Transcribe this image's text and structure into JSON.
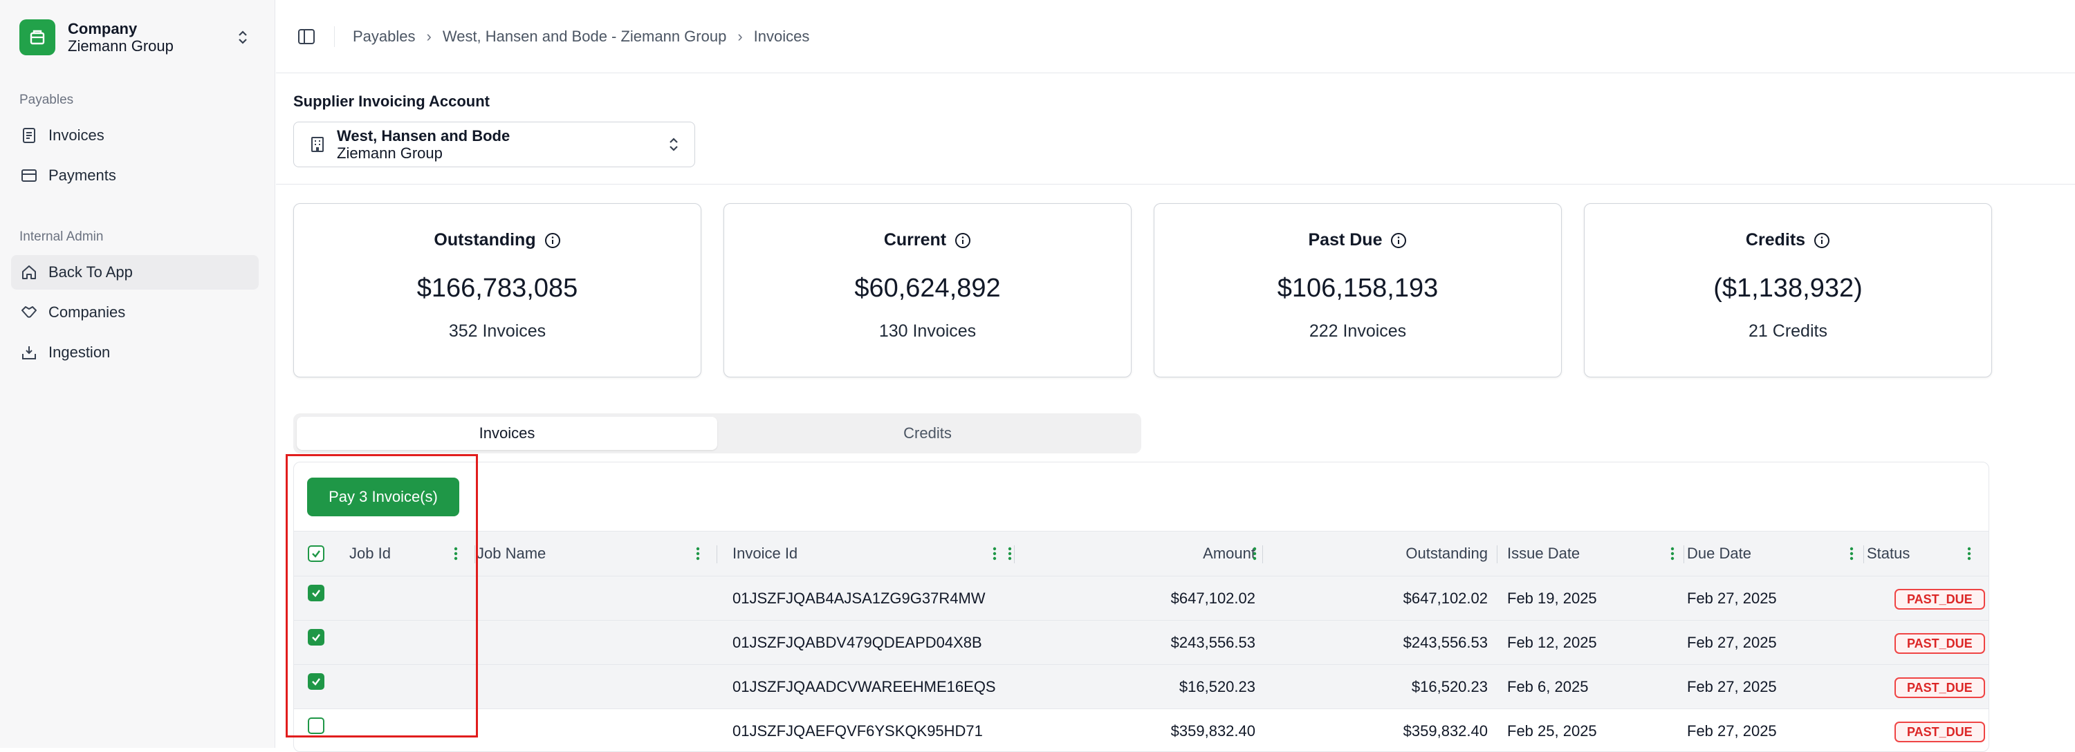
{
  "company": {
    "label": "Company",
    "name": "Ziemann Group"
  },
  "sidebar": {
    "sections": [
      {
        "label": "Payables"
      },
      {
        "label": "Internal Admin"
      }
    ],
    "items": [
      {
        "label": "Invoices",
        "icon": "invoice-icon"
      },
      {
        "label": "Payments",
        "icon": "card-icon"
      },
      {
        "label": "Back To App",
        "icon": "home-icon",
        "active": true
      },
      {
        "label": "Companies",
        "icon": "handshake-icon"
      },
      {
        "label": "Ingestion",
        "icon": "tray-download-icon"
      }
    ]
  },
  "breadcrumb": [
    "Payables",
    "West, Hansen and Bode - Ziemann Group",
    "Invoices"
  ],
  "supplier_account": {
    "label": "Supplier Invoicing Account",
    "name": "West, Hansen and Bode",
    "sub": "Ziemann Group"
  },
  "cards": [
    {
      "title": "Outstanding",
      "value": "$166,783,085",
      "sub": "352 Invoices"
    },
    {
      "title": "Current",
      "value": "$60,624,892",
      "sub": "130 Invoices"
    },
    {
      "title": "Past Due",
      "value": "$106,158,193",
      "sub": "222 Invoices"
    },
    {
      "title": "Credits",
      "value": "($1,138,932)",
      "sub": "21 Credits"
    }
  ],
  "tabs": [
    {
      "label": "Invoices",
      "active": true
    },
    {
      "label": "Credits",
      "active": false
    }
  ],
  "table": {
    "pay_button": "Pay 3 Invoice(s)",
    "columns": [
      "Job Id",
      "Job Name",
      "Invoice Id",
      "Amount",
      "Outstanding",
      "Issue Date",
      "Due Date",
      "Status"
    ],
    "rows": [
      {
        "checked": true,
        "job_id": "",
        "job_name": "",
        "invoice_id": "01JSZFJQAB4AJSA1ZG9G37R4MW",
        "amount": "$647,102.02",
        "outstanding": "$647,102.02",
        "issue_date": "Feb 19, 2025",
        "due_date": "Feb 27, 2025",
        "status": "PAST_DUE"
      },
      {
        "checked": true,
        "job_id": "",
        "job_name": "",
        "invoice_id": "01JSZFJQABDV479QDEAPD04X8B",
        "amount": "$243,556.53",
        "outstanding": "$243,556.53",
        "issue_date": "Feb 12, 2025",
        "due_date": "Feb 27, 2025",
        "status": "PAST_DUE"
      },
      {
        "checked": true,
        "job_id": "",
        "job_name": "",
        "invoice_id": "01JSZFJQAADCVWAREEHME16EQS",
        "amount": "$16,520.23",
        "outstanding": "$16,520.23",
        "issue_date": "Feb 6, 2025",
        "due_date": "Feb 27, 2025",
        "status": "PAST_DUE"
      },
      {
        "checked": false,
        "job_id": "",
        "job_name": "",
        "invoice_id": "01JSZFJQAEFQVF6YSKQK95HD71",
        "amount": "$359,832.40",
        "outstanding": "$359,832.40",
        "issue_date": "Feb 25, 2025",
        "due_date": "Feb 27, 2025",
        "status": "PAST_DUE"
      }
    ]
  },
  "colors": {
    "accent": "#1f9747",
    "status_past_due": "#dc2626",
    "highlight": "#e11d1d"
  }
}
